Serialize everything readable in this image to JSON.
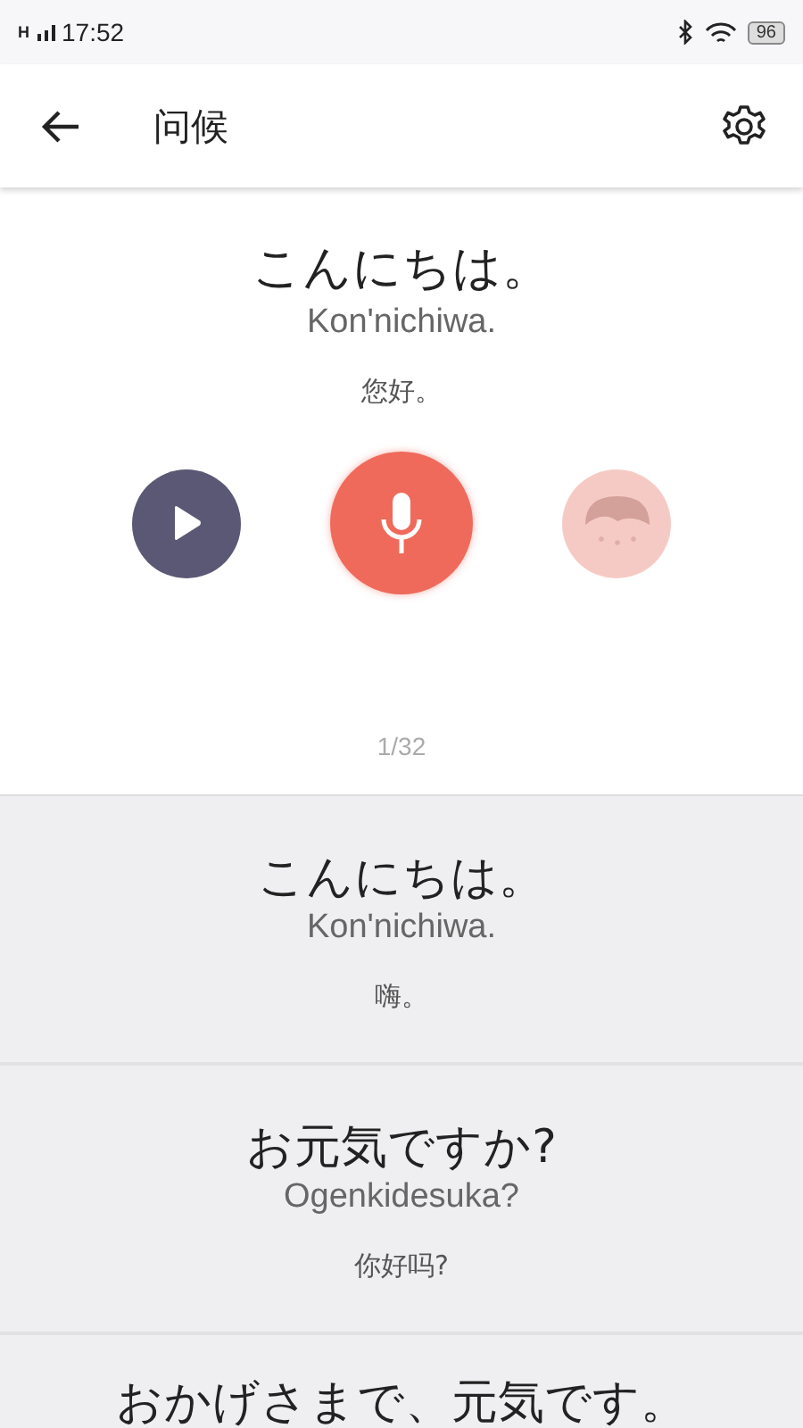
{
  "status_bar": {
    "network": "H",
    "time": "17:52",
    "battery": "96"
  },
  "header": {
    "title": "问候"
  },
  "current": {
    "phrase": "こんにちは。",
    "romaji": "Kon'nichiwa.",
    "translation": "您好。",
    "avatar_disabled": true,
    "counter": "1/32"
  },
  "phrases": [
    {
      "phrase": "こんにちは。",
      "romaji": "Kon'nichiwa.",
      "translation": "嗨。"
    },
    {
      "phrase": "お元気ですか?",
      "romaji": "Ogenkidesuka?",
      "translation": "你好吗?"
    },
    {
      "phrase": "おかげさまで、元気です。"
    }
  ]
}
